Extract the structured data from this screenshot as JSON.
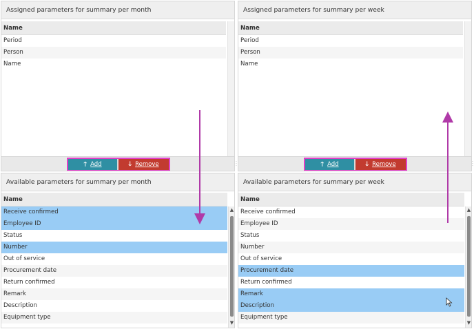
{
  "month_assigned": {
    "title": "Assigned parameters for summary per month",
    "column": "Name",
    "rows": [
      "Period",
      "Person",
      "Name"
    ]
  },
  "week_assigned": {
    "title": "Assigned parameters for summary per week",
    "column": "Name",
    "rows": [
      "Period",
      "Person",
      "Name"
    ]
  },
  "month_buttons": {
    "add": "Add",
    "remove": "Remove"
  },
  "week_buttons": {
    "add": "Add",
    "remove": "Remove"
  },
  "month_available": {
    "title": "Available parameters for summary per month",
    "column": "Name",
    "rows": [
      "Receive confirmed",
      "Employee ID",
      "Status",
      "Number",
      "Out of service",
      "Procurement date",
      "Return confirmed",
      "Remark",
      "Description",
      "Equipment type"
    ],
    "selected": [
      0,
      1,
      3
    ]
  },
  "week_available": {
    "title": "Available parameters for summary per week",
    "column": "Name",
    "rows": [
      "Receive confirmed",
      "Employee ID",
      "Status",
      "Number",
      "Out of service",
      "Procurement date",
      "Return confirmed",
      "Remark",
      "Description",
      "Equipment type"
    ],
    "selected": [
      5,
      7,
      8
    ]
  },
  "colors": {
    "selection": "#99ccf5",
    "add_button": "#2f8fa3",
    "remove_button": "#c23b2f",
    "highlight": "#e040c8",
    "arrow": "#b03aa8"
  },
  "icons": {
    "add": "arrow-up-icon",
    "remove": "arrow-down-icon",
    "cursor": "mouse-pointer-icon"
  }
}
